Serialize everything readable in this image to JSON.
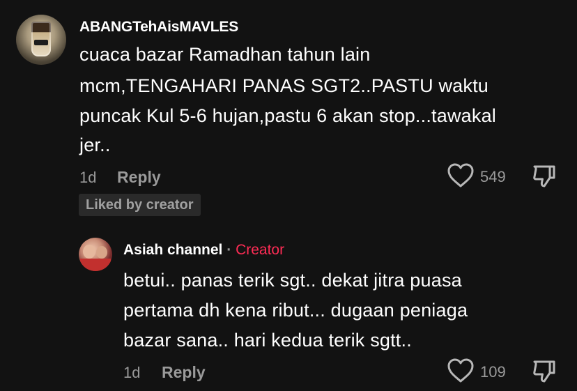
{
  "comment": {
    "username": "ABANGTehAisMAVLES",
    "text_lines": [
      "cuaca bazar Ramadhan tahun lain",
      "mcm,TENGAHARI PANAS SGT2..PASTU waktu",
      "puncak Kul 5-6 hujan,pastu 6 akan stop...tawakal",
      "jer.."
    ],
    "time": "1d",
    "reply_label": "Reply",
    "like_count": "549",
    "liked_badge": "Liked by creator"
  },
  "reply": {
    "username": "Asiah channel",
    "separator": "·",
    "creator_label": "Creator",
    "text_lines": [
      "betui.. panas terik sgt.. dekat jitra puasa",
      "pertama dh kena ribut... dugaan peniaga",
      "bazar sana.. hari kedua terik sgtt.."
    ],
    "time": "1d",
    "reply_label": "Reply",
    "like_count": "109"
  },
  "colors": {
    "background": "#121212",
    "muted": "#9a9a9a",
    "creator_accent": "#fe2c55"
  },
  "icons": {
    "like": "heart-outline-icon",
    "dislike": "thumbs-down-outline-icon"
  }
}
